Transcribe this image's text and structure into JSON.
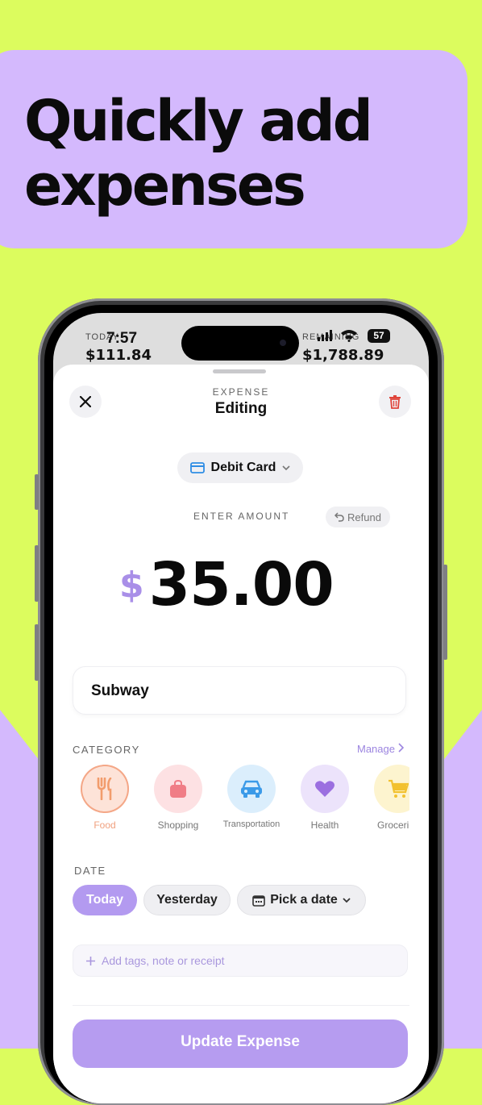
{
  "headline": {
    "line1": "Quickly add",
    "line2": "expenses"
  },
  "colors": {
    "background": "#dcfc5e",
    "accent": "#d4b9fd",
    "purple": "#a98fe8"
  },
  "status_bar": {
    "time": "7:57",
    "battery": "57"
  },
  "behind_sheet": {
    "left_label": "TODAY",
    "left_value": "$111.84",
    "right_label": "REMAINING",
    "right_value": "$1,788.89"
  },
  "sheet": {
    "eyebrow": "EXPENSE",
    "title": "Editing",
    "payment_method": "Debit Card",
    "enter_amount_label": "ENTER AMOUNT",
    "refund_label": "Refund",
    "currency": "$",
    "amount": "35.00",
    "merchant": "Subway"
  },
  "category": {
    "label": "CATEGORY",
    "manage": "Manage",
    "items": [
      {
        "label": "Food",
        "icon": "fork-knife-icon",
        "selected": true
      },
      {
        "label": "Shopping",
        "icon": "bag-icon"
      },
      {
        "label": "Transportation",
        "icon": "car-icon"
      },
      {
        "label": "Health",
        "icon": "heart-icon"
      },
      {
        "label": "Groceries",
        "icon": "cart-icon"
      }
    ]
  },
  "date": {
    "label": "DATE",
    "today": "Today",
    "yesterday": "Yesterday",
    "pick": "Pick a date"
  },
  "tags_placeholder": "Add tags, note or receipt",
  "update_button": "Update Expense"
}
